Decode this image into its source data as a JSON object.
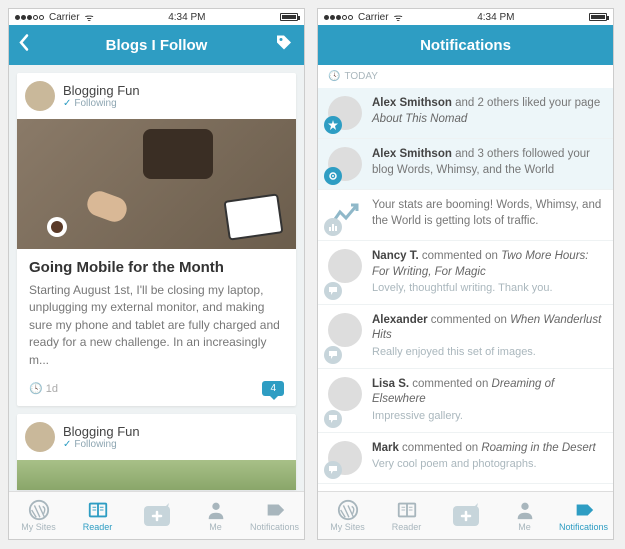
{
  "statusbar": {
    "carrier": "Carrier",
    "wifi": "ᯤ",
    "time": "4:34 PM"
  },
  "left": {
    "title": "Blogs I Follow",
    "post": {
      "blog_name": "Blogging Fun",
      "follow_status": "Following",
      "title": "Going Mobile for the Month",
      "excerpt": "Starting August 1st, I'll be closing my laptop, unplugging my external monitor, and making sure my phone and tablet are fully charged and ready for a new challenge. In an increasingly m...",
      "time_ago": "1d",
      "comment_count": "4"
    },
    "post2": {
      "blog_name": "Blogging Fun",
      "follow_status": "Following"
    }
  },
  "right": {
    "title": "Notifications",
    "section": "TODAY",
    "items": [
      {
        "actor": "Alex Smithson",
        "rest": " and 2 others liked your page ",
        "target": "About This Nomad",
        "sub": "",
        "badge": "star"
      },
      {
        "actor": "Alex Smithson",
        "rest": " and 3 others followed your blog Words, Whimsy, and the World",
        "target": "",
        "sub": "",
        "badge": "follow"
      },
      {
        "actor": "",
        "rest": "Your stats are booming! Words, Whimsy, and the World is getting lots of traffic.",
        "target": "",
        "sub": "",
        "badge": "stats"
      },
      {
        "actor": "Nancy T.",
        "rest": " commented on ",
        "target": "Two More Hours: For Writing, For Magic",
        "sub": "Lovely, thoughtful writing. Thank you.",
        "badge": "comment"
      },
      {
        "actor": "Alexander",
        "rest": " commented on ",
        "target": "When Wanderlust Hits",
        "sub": "Really enjoyed this set of images.",
        "badge": "comment"
      },
      {
        "actor": "Lisa S.",
        "rest": " commented on ",
        "target": "Dreaming of Elsewhere",
        "sub": "Impressive gallery.",
        "badge": "comment"
      },
      {
        "actor": "Mark",
        "rest": " commented on ",
        "target": "Roaming in the Desert",
        "sub": "Very cool poem and photographs.",
        "badge": "comment"
      }
    ]
  },
  "tabs": {
    "mysites": "My Sites",
    "reader": "Reader",
    "me": "Me",
    "notifications": "Notifications"
  },
  "colors": {
    "accent": "#2e9dc3"
  }
}
